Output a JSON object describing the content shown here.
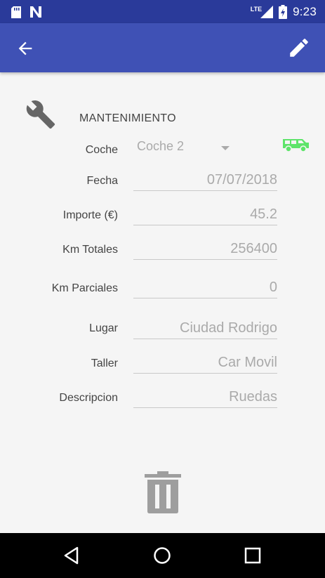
{
  "status_bar": {
    "network": "LTE",
    "time": "9:23"
  },
  "toolbar": {
    "back_icon": "arrow-back-icon",
    "edit_icon": "pencil-icon"
  },
  "form": {
    "section_title": "MANTENIMIENTO",
    "coche_label": "Coche",
    "coche_value": "Coche 2",
    "fecha_label": "Fecha",
    "fecha_value": "07/07/2018",
    "importe_label": "Importe (€)",
    "importe_value": "45.2",
    "km_totales_label": "Km Totales",
    "km_totales_value": "256400",
    "km_parciales_label": "Km Parciales",
    "km_parciales_value": "0",
    "lugar_label": "Lugar",
    "lugar_value": "Ciudad Rodrigo",
    "taller_label": "Taller",
    "taller_value": "Car Movil",
    "descripcion_label": "Descripcion",
    "descripcion_value": "Ruedas"
  },
  "colors": {
    "primary": "#3f51b5",
    "primary_dark": "#2a3a9a",
    "car_icon": "#5ee46a"
  }
}
